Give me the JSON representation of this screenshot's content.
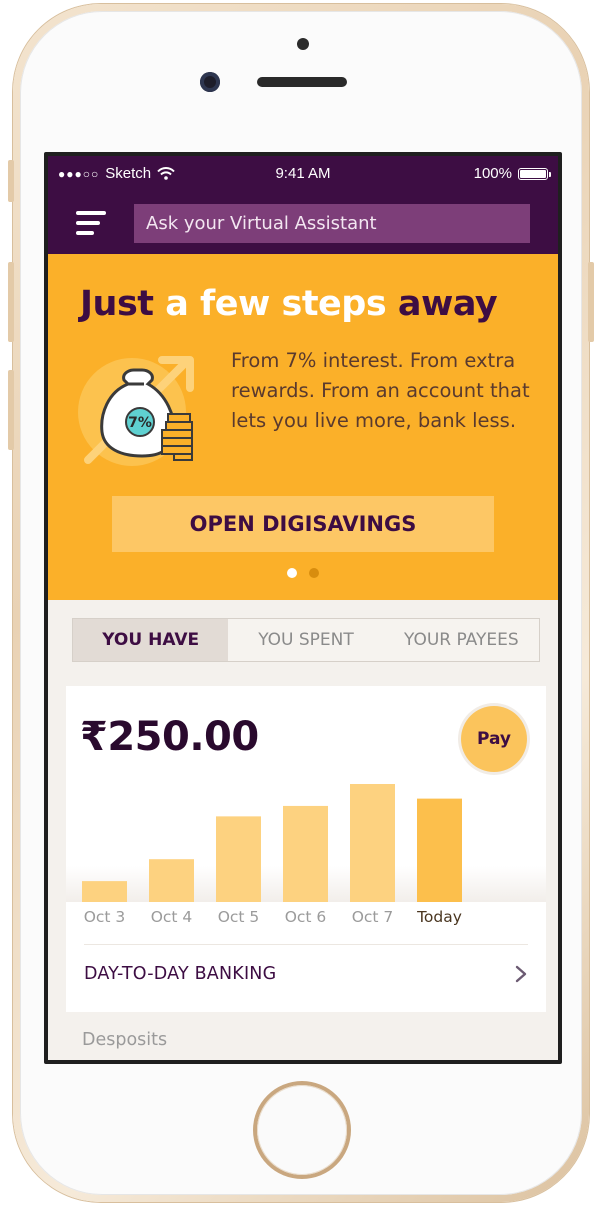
{
  "status_bar": {
    "carrier": "Sketch",
    "time": "9:41 AM",
    "battery": "100%",
    "signal_dots": "●●●○○"
  },
  "nav": {
    "search_placeholder": "Ask your Virtual Assistant"
  },
  "hero": {
    "title_part1": "Just",
    "title_part2": "a few steps",
    "title_part3": "away",
    "badge": "7%",
    "description": "From 7% interest. From extra rewards. From an account that lets you live more, bank less.",
    "cta_label": "OPEN DIGISAVINGS",
    "pager": {
      "pages": 2,
      "active": 1
    }
  },
  "tabs": [
    {
      "label": "YOU HAVE",
      "active": true
    },
    {
      "label": "YOU SPENT",
      "active": false
    },
    {
      "label": "YOUR PAYEES",
      "active": false
    }
  ],
  "account": {
    "balance": "₹250.00",
    "pay_label": "Pay",
    "link_label": "DAY-TO-DAY BANKING"
  },
  "chart_data": {
    "type": "bar",
    "categories": [
      "Oct 3",
      "Oct 4",
      "Oct 5",
      "Oct 6",
      "Oct 7",
      "Today"
    ],
    "values": [
      20,
      41,
      82,
      92,
      113,
      99
    ],
    "highlight": "Today",
    "colors": {
      "bar": "#fdd280",
      "highlight": "#fcbf4c"
    }
  },
  "section": {
    "deposits_label": "Desposits"
  },
  "colors": {
    "brand_purple": "#3d0d43",
    "hero_orange": "#fbb029",
    "search_bg": "#7d3e79"
  }
}
